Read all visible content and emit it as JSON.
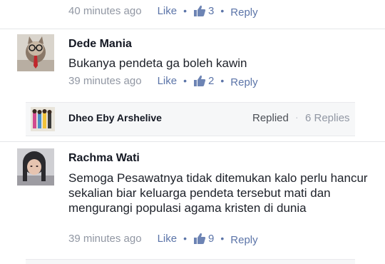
{
  "top_comment": {
    "time": "40 minutes ago",
    "like_label": "Like",
    "like_count": "3",
    "reply_label": "Reply"
  },
  "comments": [
    {
      "author": "Dede Mania",
      "text": "Bukanya pendeta ga boleh kawin",
      "time": "39 minutes ago",
      "like_label": "Like",
      "like_count": "2",
      "reply_label": "Reply"
    },
    {
      "author": "Rachma Wati",
      "text": "Semoga Pesawatnya tidak ditemukan kalo perlu hancur sekalian biar keluarga pendeta tersebut mati dan mengurangi populasi agama kristen di dunia",
      "time": "39 minutes ago",
      "like_label": "Like",
      "like_count": "9",
      "reply_label": "Reply"
    }
  ],
  "reply_preview": {
    "author": "Dheo Eby Arshelive",
    "status": "Replied",
    "separator": "·",
    "replies_count": "6 Replies"
  },
  "meta_separator": "•",
  "icons": {
    "like": "thumbs-up-icon"
  },
  "colors": {
    "link": "#5b74a8",
    "meta": "#9197a3",
    "divider": "#e5e6e9",
    "strip": "#f6f7f8"
  }
}
